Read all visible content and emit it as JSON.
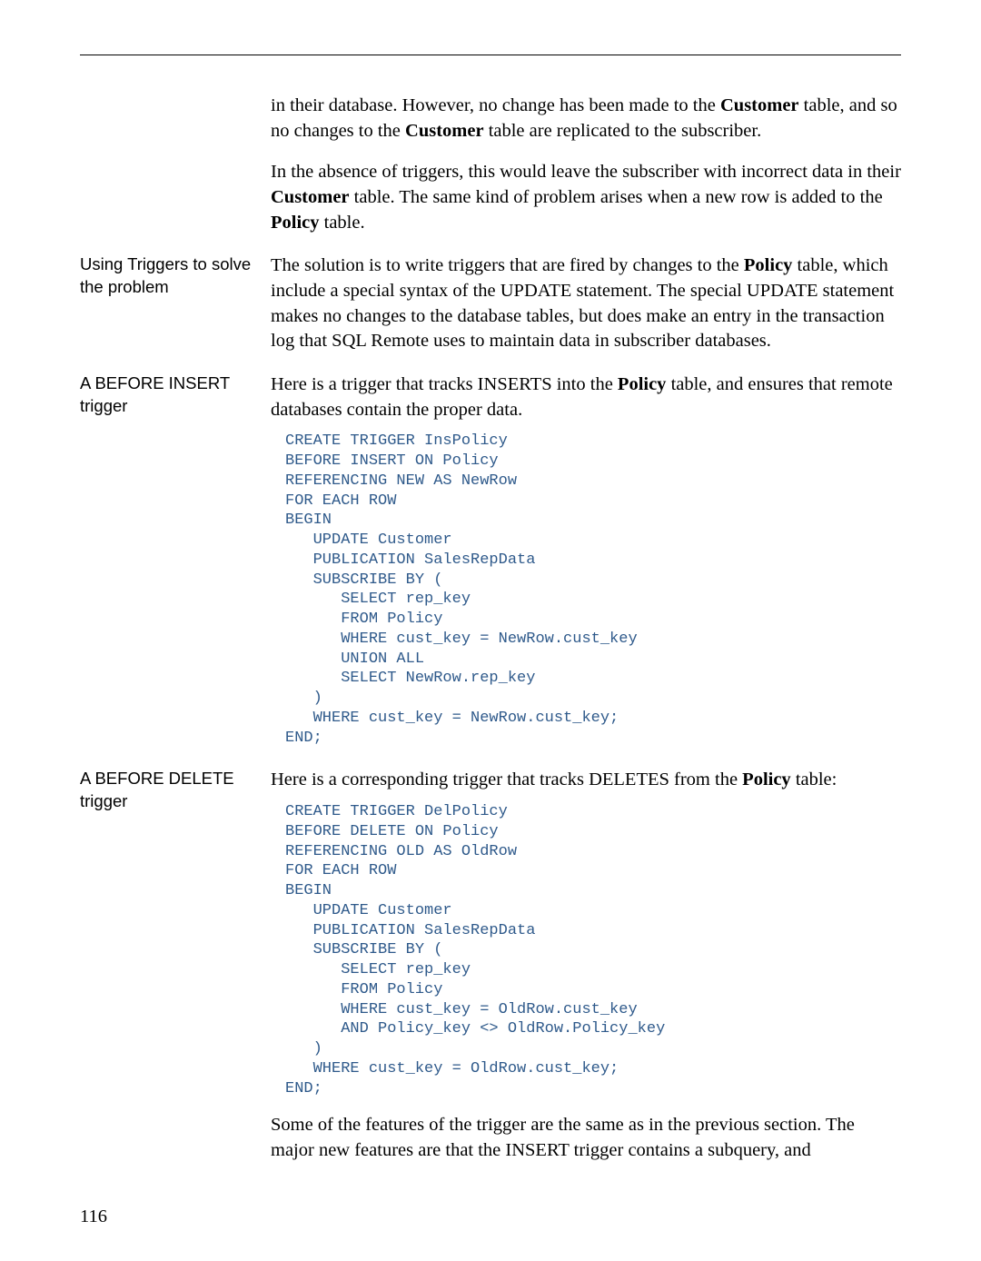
{
  "intro": {
    "p1_a": "in their database. However, no change has been made to the ",
    "p1_b": "Customer",
    "p1_c": " table, and so no changes to the ",
    "p1_d": "Customer",
    "p1_e": " table are replicated to the subscriber.",
    "p2_a": "In the absence of triggers, this would leave the subscriber with incorrect data in their ",
    "p2_b": "Customer",
    "p2_c": " table. The same kind of problem arises when a new row is added to the ",
    "p2_d": "Policy",
    "p2_e": " table."
  },
  "sec1": {
    "side": "Using Triggers to solve the problem",
    "p_a": "The solution is to write triggers that are fired by changes to the ",
    "p_b": "Policy",
    "p_c": " table, which include a special syntax of the UPDATE statement. The special UPDATE statement makes no changes to the database tables, but does make an entry in the transaction log that SQL Remote uses to maintain data in subscriber databases."
  },
  "sec2": {
    "side": "A BEFORE INSERT trigger",
    "p_a": "Here is a trigger that tracks INSERTS into the ",
    "p_b": "Policy",
    "p_c": " table, and ensures that remote databases contain the proper data.",
    "code": "CREATE TRIGGER InsPolicy\nBEFORE INSERT ON Policy\nREFERENCING NEW AS NewRow\nFOR EACH ROW\nBEGIN\n   UPDATE Customer\n   PUBLICATION SalesRepData\n   SUBSCRIBE BY (\n      SELECT rep_key\n      FROM Policy\n      WHERE cust_key = NewRow.cust_key\n      UNION ALL\n      SELECT NewRow.rep_key\n   )\n   WHERE cust_key = NewRow.cust_key;\nEND;"
  },
  "sec3": {
    "side": "A BEFORE DELETE trigger",
    "p_a": "Here is a corresponding trigger that tracks DELETES from the ",
    "p_b": "Policy",
    "p_c": " table:",
    "code": "CREATE TRIGGER DelPolicy\nBEFORE DELETE ON Policy\nREFERENCING OLD AS OldRow\nFOR EACH ROW\nBEGIN\n   UPDATE Customer\n   PUBLICATION SalesRepData\n   SUBSCRIBE BY (\n      SELECT rep_key\n      FROM Policy\n      WHERE cust_key = OldRow.cust_key\n      AND Policy_key <> OldRow.Policy_key\n   )\n   WHERE cust_key = OldRow.cust_key;\nEND;",
    "p2": "Some of the features of the trigger are the same as in the previous section. The major new features are that the INSERT trigger contains a subquery, and"
  },
  "pagenum": "116"
}
